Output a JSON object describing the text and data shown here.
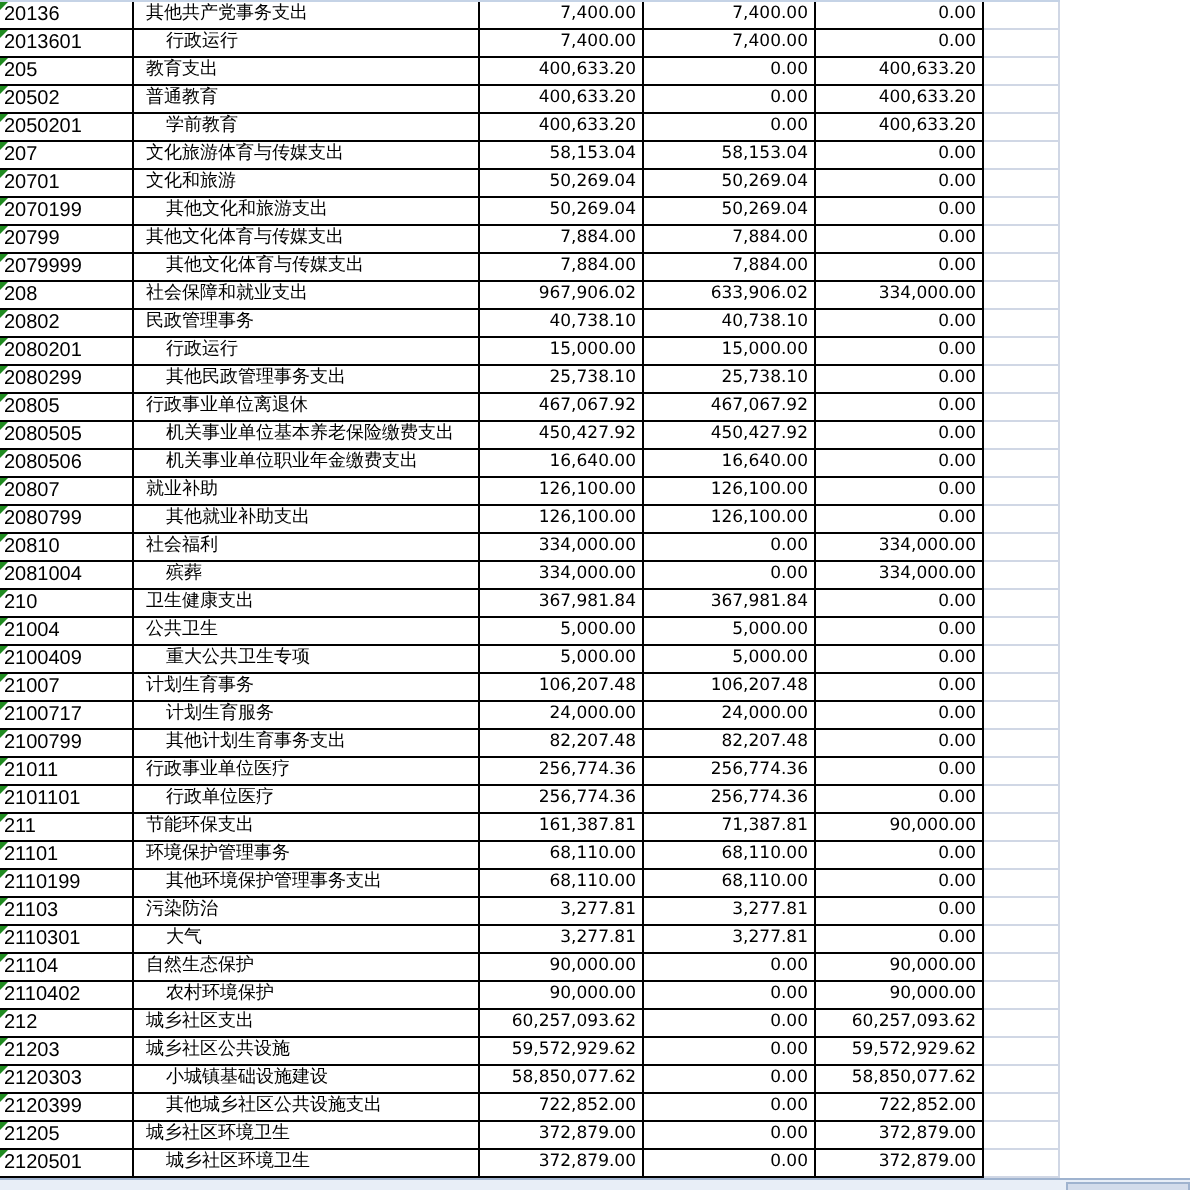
{
  "sheet": {
    "rows": [
      {
        "code": "20136",
        "name": "其他共产党事务支出",
        "indented": false,
        "c3": "7,400.00",
        "c4": "7,400.00",
        "c5": "0.00"
      },
      {
        "code": "2013601",
        "name": "行政运行",
        "indented": true,
        "c3": "7,400.00",
        "c4": "7,400.00",
        "c5": "0.00"
      },
      {
        "code": "205",
        "name": "教育支出",
        "indented": false,
        "c3": "400,633.20",
        "c4": "0.00",
        "c5": "400,633.20"
      },
      {
        "code": "20502",
        "name": "普通教育",
        "indented": false,
        "c3": "400,633.20",
        "c4": "0.00",
        "c5": "400,633.20"
      },
      {
        "code": "2050201",
        "name": "学前教育",
        "indented": true,
        "c3": "400,633.20",
        "c4": "0.00",
        "c5": "400,633.20"
      },
      {
        "code": "207",
        "name": "文化旅游体育与传媒支出",
        "indented": false,
        "c3": "58,153.04",
        "c4": "58,153.04",
        "c5": "0.00"
      },
      {
        "code": "20701",
        "name": "文化和旅游",
        "indented": false,
        "c3": "50,269.04",
        "c4": "50,269.04",
        "c5": "0.00"
      },
      {
        "code": "2070199",
        "name": "其他文化和旅游支出",
        "indented": true,
        "c3": "50,269.04",
        "c4": "50,269.04",
        "c5": "0.00"
      },
      {
        "code": "20799",
        "name": "其他文化体育与传媒支出",
        "indented": false,
        "c3": "7,884.00",
        "c4": "7,884.00",
        "c5": "0.00"
      },
      {
        "code": "2079999",
        "name": "其他文化体育与传媒支出",
        "indented": true,
        "c3": "7,884.00",
        "c4": "7,884.00",
        "c5": "0.00"
      },
      {
        "code": "208",
        "name": "社会保障和就业支出",
        "indented": false,
        "c3": "967,906.02",
        "c4": "633,906.02",
        "c5": "334,000.00"
      },
      {
        "code": "20802",
        "name": "民政管理事务",
        "indented": false,
        "c3": "40,738.10",
        "c4": "40,738.10",
        "c5": "0.00"
      },
      {
        "code": "2080201",
        "name": "行政运行",
        "indented": true,
        "c3": "15,000.00",
        "c4": "15,000.00",
        "c5": "0.00"
      },
      {
        "code": "2080299",
        "name": "其他民政管理事务支出",
        "indented": true,
        "c3": "25,738.10",
        "c4": "25,738.10",
        "c5": "0.00"
      },
      {
        "code": "20805",
        "name": "行政事业单位离退休",
        "indented": false,
        "c3": "467,067.92",
        "c4": "467,067.92",
        "c5": "0.00"
      },
      {
        "code": "2080505",
        "name": "机关事业单位基本养老保险缴费支出",
        "indented": true,
        "c3": "450,427.92",
        "c4": "450,427.92",
        "c5": "0.00"
      },
      {
        "code": "2080506",
        "name": "机关事业单位职业年金缴费支出",
        "indented": true,
        "c3": "16,640.00",
        "c4": "16,640.00",
        "c5": "0.00"
      },
      {
        "code": "20807",
        "name": "就业补助",
        "indented": false,
        "c3": "126,100.00",
        "c4": "126,100.00",
        "c5": "0.00"
      },
      {
        "code": "2080799",
        "name": "其他就业补助支出",
        "indented": true,
        "c3": "126,100.00",
        "c4": "126,100.00",
        "c5": "0.00"
      },
      {
        "code": "20810",
        "name": "社会福利",
        "indented": false,
        "c3": "334,000.00",
        "c4": "0.00",
        "c5": "334,000.00"
      },
      {
        "code": "2081004",
        "name": "殡葬",
        "indented": true,
        "c3": "334,000.00",
        "c4": "0.00",
        "c5": "334,000.00"
      },
      {
        "code": "210",
        "name": "卫生健康支出",
        "indented": false,
        "c3": "367,981.84",
        "c4": "367,981.84",
        "c5": "0.00"
      },
      {
        "code": "21004",
        "name": "公共卫生",
        "indented": false,
        "c3": "5,000.00",
        "c4": "5,000.00",
        "c5": "0.00"
      },
      {
        "code": "2100409",
        "name": "重大公共卫生专项",
        "indented": true,
        "c3": "5,000.00",
        "c4": "5,000.00",
        "c5": "0.00"
      },
      {
        "code": "21007",
        "name": "计划生育事务",
        "indented": false,
        "c3": "106,207.48",
        "c4": "106,207.48",
        "c5": "0.00"
      },
      {
        "code": "2100717",
        "name": "计划生育服务",
        "indented": true,
        "c3": "24,000.00",
        "c4": "24,000.00",
        "c5": "0.00"
      },
      {
        "code": "2100799",
        "name": "其他计划生育事务支出",
        "indented": true,
        "c3": "82,207.48",
        "c4": "82,207.48",
        "c5": "0.00"
      },
      {
        "code": "21011",
        "name": "行政事业单位医疗",
        "indented": false,
        "c3": "256,774.36",
        "c4": "256,774.36",
        "c5": "0.00"
      },
      {
        "code": "2101101",
        "name": "行政单位医疗",
        "indented": true,
        "c3": "256,774.36",
        "c4": "256,774.36",
        "c5": "0.00"
      },
      {
        "code": "211",
        "name": "节能环保支出",
        "indented": false,
        "c3": "161,387.81",
        "c4": "71,387.81",
        "c5": "90,000.00"
      },
      {
        "code": "21101",
        "name": "环境保护管理事务",
        "indented": false,
        "c3": "68,110.00",
        "c4": "68,110.00",
        "c5": "0.00"
      },
      {
        "code": "2110199",
        "name": "其他环境保护管理事务支出",
        "indented": true,
        "c3": "68,110.00",
        "c4": "68,110.00",
        "c5": "0.00"
      },
      {
        "code": "21103",
        "name": "污染防治",
        "indented": false,
        "c3": "3,277.81",
        "c4": "3,277.81",
        "c5": "0.00"
      },
      {
        "code": "2110301",
        "name": "大气",
        "indented": true,
        "c3": "3,277.81",
        "c4": "3,277.81",
        "c5": "0.00"
      },
      {
        "code": "21104",
        "name": "自然生态保护",
        "indented": false,
        "c3": "90,000.00",
        "c4": "0.00",
        "c5": "90,000.00"
      },
      {
        "code": "2110402",
        "name": "农村环境保护",
        "indented": true,
        "c3": "90,000.00",
        "c4": "0.00",
        "c5": "90,000.00"
      },
      {
        "code": "212",
        "name": "城乡社区支出",
        "indented": false,
        "c3": "60,257,093.62",
        "c4": "0.00",
        "c5": "60,257,093.62"
      },
      {
        "code": "21203",
        "name": "城乡社区公共设施",
        "indented": false,
        "c3": "59,572,929.62",
        "c4": "0.00",
        "c5": "59,572,929.62"
      },
      {
        "code": "2120303",
        "name": "小城镇基础设施建设",
        "indented": true,
        "c3": "58,850,077.62",
        "c4": "0.00",
        "c5": "58,850,077.62"
      },
      {
        "code": "2120399",
        "name": "其他城乡社区公共设施支出",
        "indented": true,
        "c3": "722,852.00",
        "c4": "0.00",
        "c5": "722,852.00"
      },
      {
        "code": "21205",
        "name": "城乡社区环境卫生",
        "indented": false,
        "c3": "372,879.00",
        "c4": "0.00",
        "c5": "372,879.00"
      },
      {
        "code": "2120501",
        "name": "城乡社区环境卫生",
        "indented": true,
        "c3": "372,879.00",
        "c4": "0.00",
        "c5": "372,879.00"
      }
    ]
  }
}
